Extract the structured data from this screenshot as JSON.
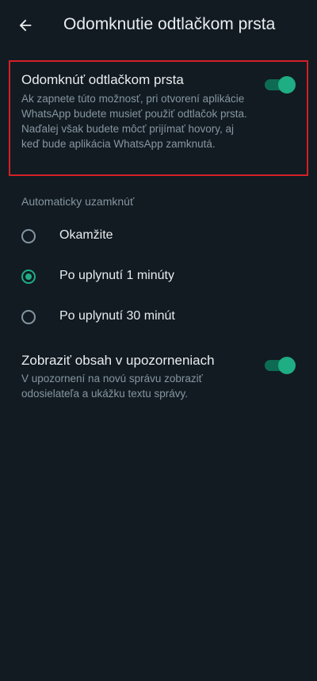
{
  "header": {
    "back_icon": "arrow-left-icon",
    "title": "Odomknutie odtlačkom prsta"
  },
  "fingerprint_unlock": {
    "title": "Odomknúť odtlačkom prsta",
    "description": "Ak zapnete túto možnosť, pri otvorení aplikácie WhatsApp budete musieť použiť odtlačok prsta. Naďalej však budete môcť prijímať hovory, aj keď bude aplikácia WhatsApp zamknutá.",
    "enabled": true
  },
  "auto_lock": {
    "header": "Automaticky uzamknúť",
    "options": [
      {
        "label": "Okamžite",
        "selected": false
      },
      {
        "label": "Po uplynutí 1 minúty",
        "selected": true
      },
      {
        "label": "Po uplynutí 30 minút",
        "selected": false
      }
    ]
  },
  "show_content": {
    "title": "Zobraziť obsah v upozorneniach",
    "description": "V upozornení na novú správu zobraziť odosielateľa a ukážku textu správy.",
    "enabled": true
  },
  "colors": {
    "background": "#121b22",
    "accent": "#1fad83",
    "highlight": "#d42027"
  }
}
